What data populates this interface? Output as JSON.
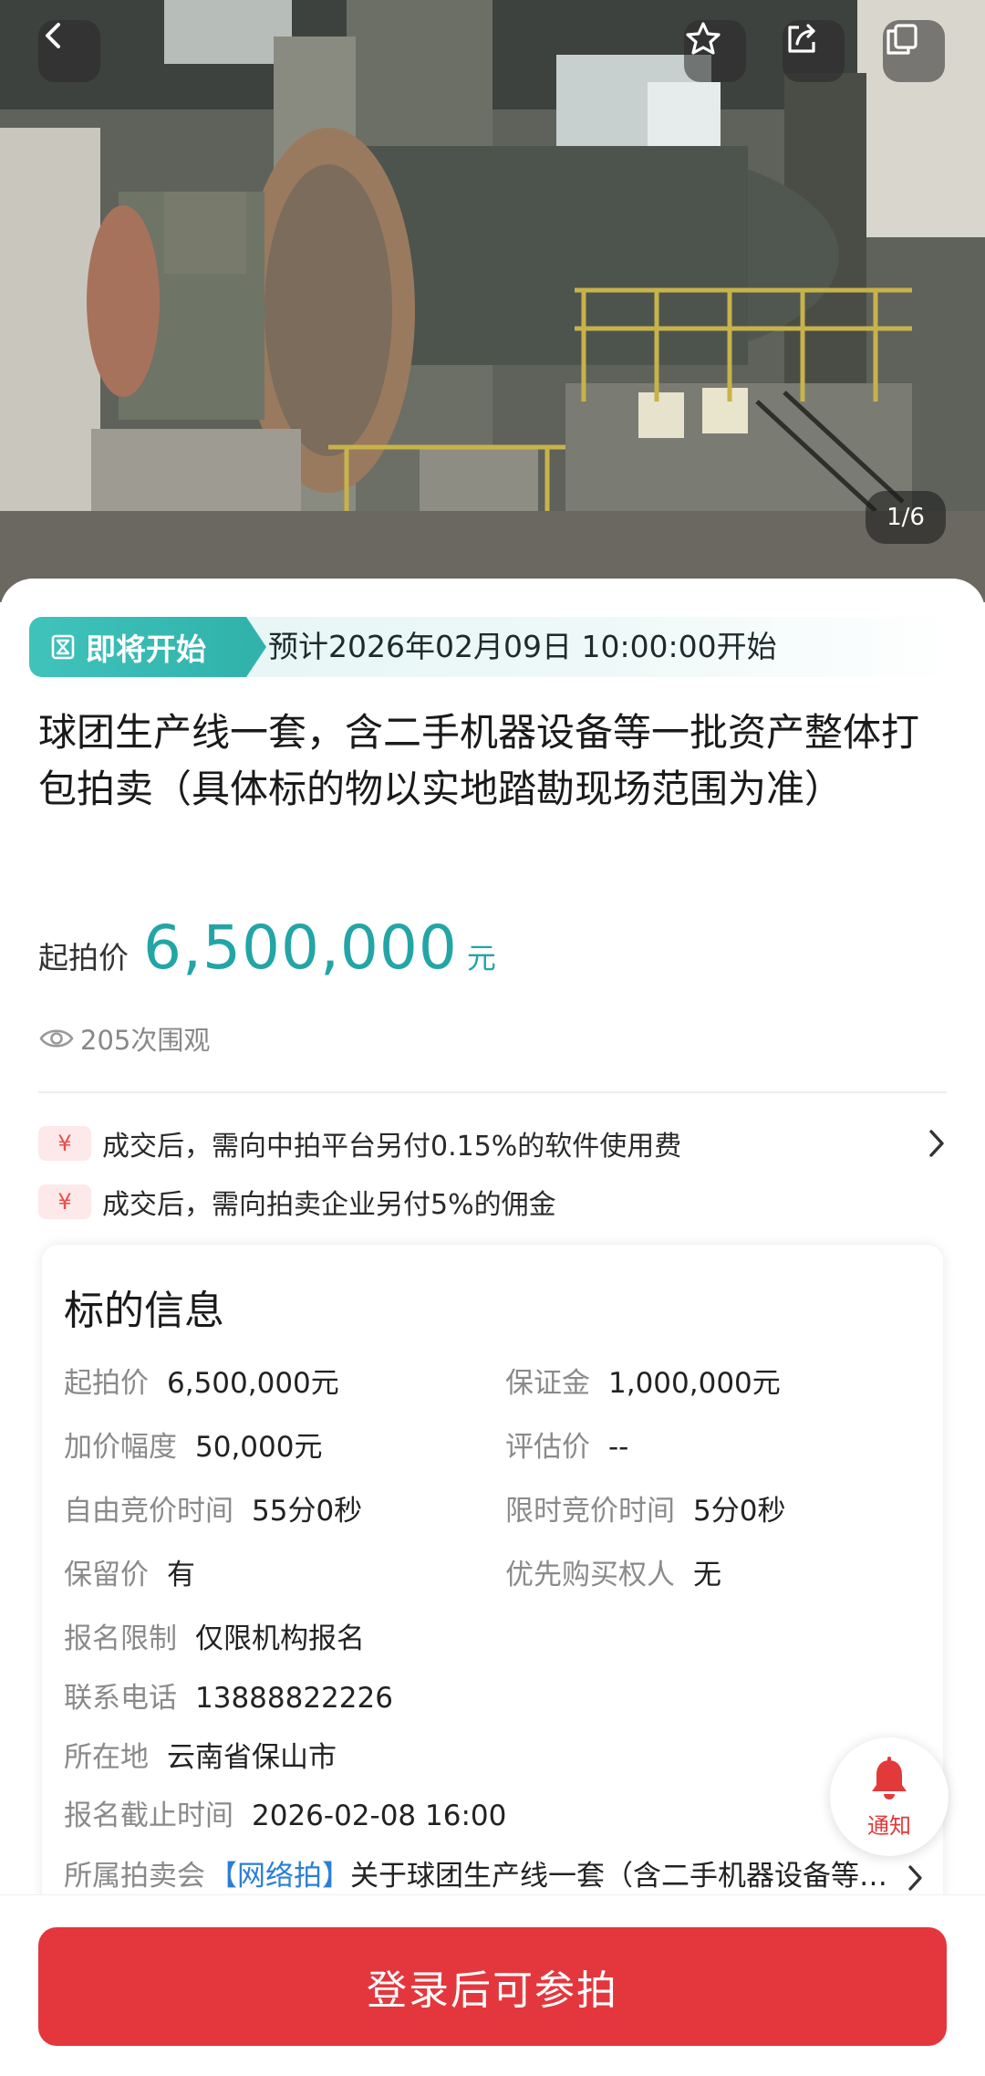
{
  "gallery": {
    "counter": "1/6"
  },
  "status": {
    "tag": "即将开始",
    "time": "预计2026年02月09日 10:00:00开始"
  },
  "title": "球团生产线一套，含二手机器设备等一批资产整体打包拍卖（具体标的物以实地踏勘现场范围为准）",
  "price": {
    "label": "起拍价",
    "value": "6,500,000",
    "unit": "元"
  },
  "views": "205次围观",
  "fees": [
    {
      "badge": "¥",
      "text": "成交后，需向中拍平台另付0.15%的软件使用费"
    },
    {
      "badge": "¥",
      "text": "成交后，需向拍卖企业另付5%的佣金"
    }
  ],
  "info": {
    "title": "标的信息",
    "start_price": {
      "k": "起拍价",
      "v": "6,500,000元"
    },
    "deposit": {
      "k": "保证金",
      "v": "1,000,000元"
    },
    "increment": {
      "k": "加价幅度",
      "v": "50,000元"
    },
    "appraisal": {
      "k": "评估价",
      "v": "--"
    },
    "free_time": {
      "k": "自由竞价时间",
      "v": "55分0秒"
    },
    "limit_time": {
      "k": "限时竞价时间",
      "v": "5分0秒"
    },
    "reserve": {
      "k": "保留价",
      "v": "有"
    },
    "priority": {
      "k": "优先购买权人",
      "v": "无"
    },
    "restriction": {
      "k": "报名限制",
      "v": "仅限机构报名"
    },
    "phone": {
      "k": "联系电话",
      "v": "13888822226"
    },
    "location": {
      "k": "所在地",
      "v": "云南省保山市"
    },
    "deadline": {
      "k": "报名截止时间",
      "v": "2026-02-08 16:00"
    },
    "auction": {
      "k": "所属拍卖会",
      "tag": "【网络拍】",
      "v": "关于球团生产线一套（含二手机器设备等…"
    }
  },
  "notify": {
    "label": "通知"
  },
  "cta": "登录后可参拍",
  "colors": {
    "accent": "#23a5a6",
    "danger": "#e4373d",
    "tag": "#3fc3bb"
  }
}
